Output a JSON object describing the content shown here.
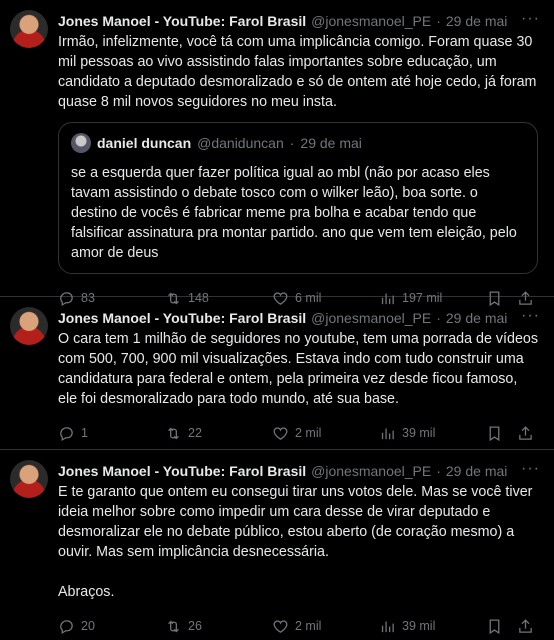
{
  "tweets": [
    {
      "name": "Jones Manoel - YouTube: Farol Brasil",
      "handle": "@jonesmanoel_PE",
      "dot": "·",
      "date": "29 de mai",
      "text": "Irmão, infelizmente, você tá com uma implicância comigo. Foram quase 30 mil pessoas ao vivo assistindo falas importantes sobre educação, um candidato a deputado desmoralizado e só de ontem até hoje cedo, já foram quase 8 mil novos seguidores no meu insta.",
      "quote": {
        "name": "daniel duncan",
        "handle": "@daniduncan",
        "dot": "·",
        "date": "29 de mai",
        "text": "se a esquerda quer fazer política igual ao mbl (não por acaso eles tavam assistindo o debate tosco com o wilker leão), boa sorte. o destino de vocês é fabricar meme pra bolha e acabar tendo que falsificar assinatura pra montar partido. ano que vem tem eleição, pelo amor de deus"
      },
      "replies": "83",
      "reposts": "148",
      "likes": "6 mil",
      "views": "197 mil"
    },
    {
      "name": "Jones Manoel - YouTube: Farol Brasil",
      "handle": "@jonesmanoel_PE",
      "dot": "·",
      "date": "29 de mai",
      "text": "O cara tem 1 milhão de seguidores no youtube, tem uma porrada de vídeos com 500, 700, 900 mil visualizações. Estava indo com tudo construir uma candidatura para federal e ontem, pela primeira vez desde ficou famoso, ele foi desmoralizado para todo mundo, até sua base.",
      "replies": "1",
      "reposts": "22",
      "likes": "2 mil",
      "views": "39 mil"
    },
    {
      "name": "Jones Manoel - YouTube: Farol Brasil",
      "handle": "@jonesmanoel_PE",
      "dot": "·",
      "date": "29 de mai",
      "text": "E te garanto que ontem eu consegui tirar uns votos dele. Mas se você tiver ideia melhor sobre como impedir um cara desse de virar deputado e desmoralizar ele no debate público, estou aberto (de coração mesmo) a ouvir. Mas sem implicância desnecessária.\n\nAbraços.",
      "replies": "20",
      "reposts": "26",
      "likes": "2 mil",
      "views": "39 mil"
    }
  ],
  "icons": {
    "reply": "reply-icon",
    "repost": "repost-icon",
    "like": "heart-icon",
    "views": "views-icon",
    "bookmark": "bookmark-icon",
    "share": "share-icon",
    "more": "more-icon"
  },
  "more_glyph": "···"
}
